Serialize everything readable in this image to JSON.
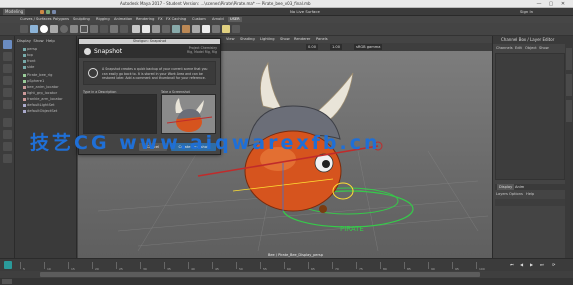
{
  "titlebar": {
    "text": "Autodesk Maya 2017 - Student Version: ...\\scenes\\Pirate\\Pirate.ma* --- Pirate_bee_v03_final.mb",
    "win_minimize": "—",
    "win_maximize": "▢",
    "win_close": "✕"
  },
  "statusline": {
    "mode": "Modeling",
    "no_live_surface": "No Live Surface",
    "sign_in": "Sign In"
  },
  "shelf": {
    "tabs": [
      "Curves / Surfaces",
      "Polygons",
      "Sculpting",
      "Rigging",
      "Animation",
      "Rendering",
      "FX",
      "FX Caching",
      "Custom",
      "Arnold",
      "Bifrost",
      "MASH",
      "Motion Graphics",
      "XGen",
      "USER"
    ],
    "active_tab": "USER"
  },
  "outliner": {
    "menu": [
      "Display",
      "Show",
      "Help"
    ],
    "items": [
      "persp",
      "top",
      "front",
      "side",
      "Pirate_bee_rig",
      "pSphere1",
      "bee_anim_locator",
      "light_grp_locator",
      "frankie_arm_locator",
      "defaultLightSet",
      "defaultObjectSet"
    ]
  },
  "viewport": {
    "menu": [
      "View",
      "Shading",
      "Lighting",
      "Show",
      "Renderer",
      "Panels"
    ],
    "frame_field": "0.00",
    "scale_field": "1.00",
    "color_space": "sRGB gamma",
    "camera_label": "persp",
    "bottom_label": "Bee / Pirate_Bee_Display_persp"
  },
  "channelbox": {
    "title": "Channel Box / Layer Editor",
    "menu": [
      "Channels",
      "Edit",
      "Object",
      "Show"
    ]
  },
  "layers": {
    "tabs": [
      "Display",
      "Anim"
    ],
    "menu": [
      "Layers",
      "Options",
      "Help"
    ]
  },
  "dialog": {
    "window_title": "Shotgun: Snapshot",
    "title": "Snapshot",
    "project": "Project Chemistry",
    "context": "Rig, Model Rig, Rig",
    "info_text": "A Snapshot creates a quick backup of your current scene that you can easily go back to. It is stored in your Work Area and can be restored later. Add a comment and thumbnail for your reference.",
    "comment_label": "Type in a Description",
    "thumbnail_label": "Take a Screenshot",
    "cancel_label": "Cancel",
    "create_label": "Create Snapshot"
  },
  "timeline": {
    "ticks": [
      "5",
      "10",
      "15",
      "20",
      "25",
      "30",
      "35",
      "40",
      "45",
      "50",
      "55",
      "60",
      "65",
      "70",
      "75",
      "80",
      "85",
      "90",
      "95",
      "100",
      "105",
      "110",
      "115",
      "120"
    ]
  },
  "watermark": "技艺CG www.aiqwarexfb.cn",
  "colors": {
    "accent": "#1f6fd6",
    "bee_body": "#d6541e",
    "horn": "#e9e4d8",
    "ring_green": "#36c94a"
  }
}
